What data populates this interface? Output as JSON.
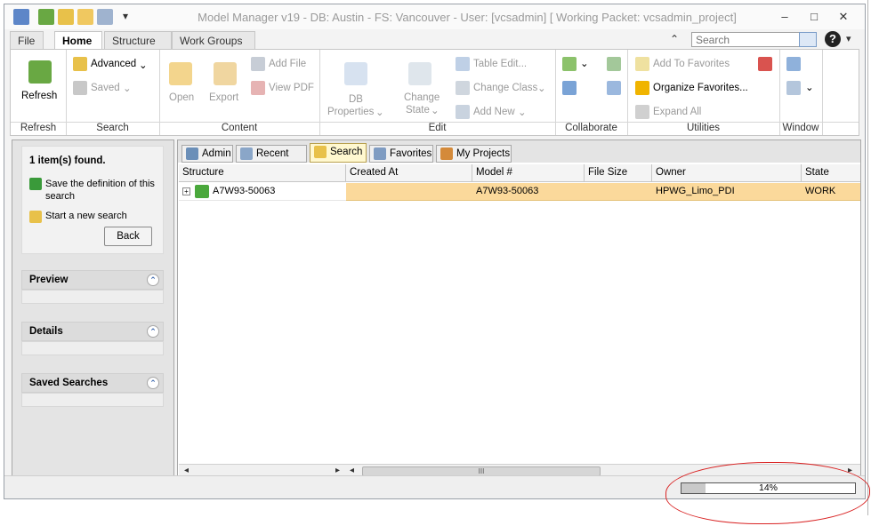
{
  "window": {
    "title": "Model Manager v19 - DB: Austin - FS: Vancouver - User: [vcsadmin] [ Working Packet: vcsadmin_project]",
    "controls": {
      "minimize": "–",
      "maximize": "□",
      "close": "✕"
    }
  },
  "quick_access": {
    "dropdown": "▾"
  },
  "menu_tabs": [
    {
      "label": "File",
      "active": false
    },
    {
      "label": "Home",
      "active": true
    },
    {
      "label": "Structure",
      "active": false
    },
    {
      "label": "Work Groups",
      "active": false
    }
  ],
  "search": {
    "placeholder": "Search",
    "collapse_glyph": "⌃",
    "help": "?"
  },
  "ribbon": {
    "refresh": {
      "label": "Refresh"
    },
    "search_group": {
      "advanced": "Advanced",
      "saved": "Saved"
    },
    "content": {
      "open": "Open",
      "export": "Export",
      "add_file": "Add File",
      "view_pdf": "View PDF"
    },
    "edit": {
      "db_properties_1": "DB",
      "db_properties_2": "Properties",
      "change_state_1": "Change",
      "change_state_2": "State",
      "table_edit": "Table Edit...",
      "change_class": "Change Class",
      "add_new": "Add New"
    },
    "utilities": {
      "add_to_favorites": "Add To Favorites",
      "organize_favorites": "Organize Favorites...",
      "expand_all": "Expand All"
    },
    "group_labels": [
      "Refresh",
      "Search",
      "Content",
      "Edit",
      "Collaborate",
      "Utilities",
      "Window"
    ]
  },
  "left_panel": {
    "found_text": "1 item(s) found.",
    "save_definition": "Save the definition of this search",
    "start_new": "Start a new search",
    "back": "Back",
    "sections": [
      "Preview",
      "Details",
      "Saved Searches"
    ]
  },
  "content_tabs": [
    {
      "label": "Admin",
      "active": false
    },
    {
      "label": "Recent List",
      "active": false
    },
    {
      "label": "Search",
      "active": true
    },
    {
      "label": "Favorites",
      "active": false
    },
    {
      "label": "My Projects",
      "active": false
    }
  ],
  "grid": {
    "columns": [
      "Structure",
      "Created At",
      "Model #",
      "File Size",
      "Owner",
      "State"
    ],
    "rows": [
      {
        "structure": "A7W93-50063",
        "created_at": "",
        "model": "A7W93-50063",
        "file_size": "",
        "owner": "HPWG_Limo_PDI",
        "state": "WORK"
      }
    ]
  },
  "scrollbar": {
    "left": "◂",
    "right": "▸",
    "grip": "III"
  },
  "status": {
    "progress_percent": 14,
    "progress_label": "14%"
  },
  "colors": {
    "selected_row": "#fbd99b",
    "annotation": "#d92323"
  }
}
